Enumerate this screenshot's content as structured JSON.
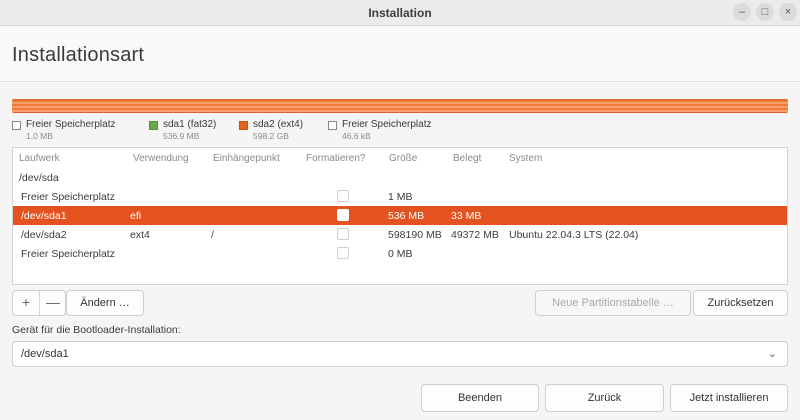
{
  "window": {
    "title": "Installation",
    "controls": {
      "minimize": "–",
      "maximize": "□",
      "close": "×"
    }
  },
  "page": {
    "title": "Installationsart"
  },
  "legend": [
    {
      "name": "Freier Speicherplatz",
      "size": "1.0 MB",
      "color": "#ffffff"
    },
    {
      "name": "sda1 (fat32)",
      "size": "536.9 MB",
      "color": "#6aa84f"
    },
    {
      "name": "sda2 (ext4)",
      "size": "598.2 GB",
      "color": "#e4641f"
    },
    {
      "name": "Freier Speicherplatz",
      "size": "46.6 kB",
      "color": "#ffffff"
    }
  ],
  "table": {
    "headers": [
      "Laufwerk",
      "Verwendung",
      "Einhängepunkt",
      "Formatieren?",
      "Größe",
      "Belegt",
      "System"
    ],
    "device": "/dev/sda",
    "rows": [
      {
        "device": "Freier Speicherplatz",
        "usage": "",
        "mount": "",
        "size": "1 MB",
        "used": "",
        "system": "",
        "selected": false
      },
      {
        "device": "/dev/sda1",
        "usage": "efi",
        "mount": "",
        "size": "536 MB",
        "used": "33 MB",
        "system": "",
        "selected": true
      },
      {
        "device": "/dev/sda2",
        "usage": "ext4",
        "mount": "/",
        "size": "598190 MB",
        "used": "49372 MB",
        "system": "Ubuntu 22.04.3 LTS (22.04)",
        "selected": false
      },
      {
        "device": "Freier Speicherplatz",
        "usage": "",
        "mount": "",
        "size": "0 MB",
        "used": "",
        "system": "",
        "selected": false
      }
    ]
  },
  "actions": {
    "add": "+",
    "remove": "—",
    "change": "Ändern …",
    "new_table": "Neue Partitionstabelle …",
    "reset": "Zurücksetzen"
  },
  "bootloader": {
    "label": "Gerät für die Bootloader-Installation:",
    "value": "/dev/sda1"
  },
  "footer": {
    "quit": "Beenden",
    "back": "Zurück",
    "install": "Jetzt installieren"
  },
  "colors": {
    "accent": "#e4531f",
    "bar": "#f0783a"
  }
}
